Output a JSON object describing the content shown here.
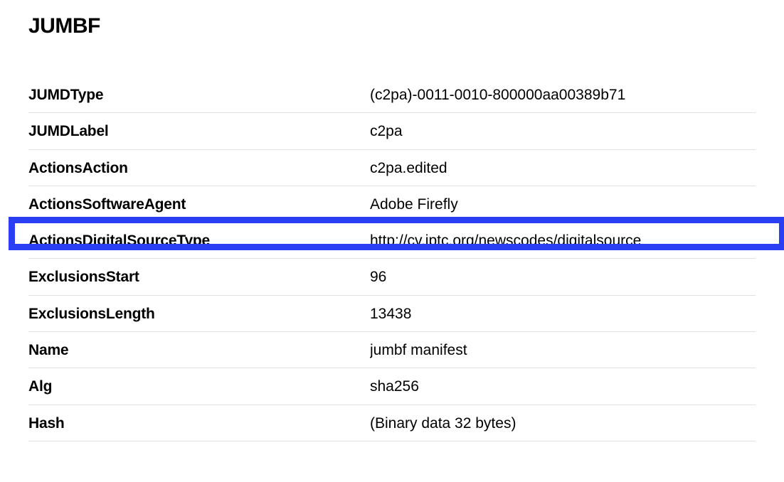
{
  "section": {
    "title": "JUMBF"
  },
  "rows": [
    {
      "key": "JUMDType",
      "value": "(c2pa)-0011-0010-800000aa00389b71"
    },
    {
      "key": "JUMDLabel",
      "value": "c2pa"
    },
    {
      "key": "ActionsAction",
      "value": "c2pa.edited"
    },
    {
      "key": "ActionsSoftwareAgent",
      "value": "Adobe Firefly"
    },
    {
      "key": "ActionsDigitalSourceType",
      "value": "http://cv.iptc.org/newscodes/digitalsource"
    },
    {
      "key": "ExclusionsStart",
      "value": "96"
    },
    {
      "key": "ExclusionsLength",
      "value": "13438"
    },
    {
      "key": "Name",
      "value": "jumbf manifest"
    },
    {
      "key": "Alg",
      "value": "sha256"
    },
    {
      "key": "Hash",
      "value": "(Binary data 32 bytes)"
    }
  ],
  "highlight": {
    "rowIndex": 4
  }
}
